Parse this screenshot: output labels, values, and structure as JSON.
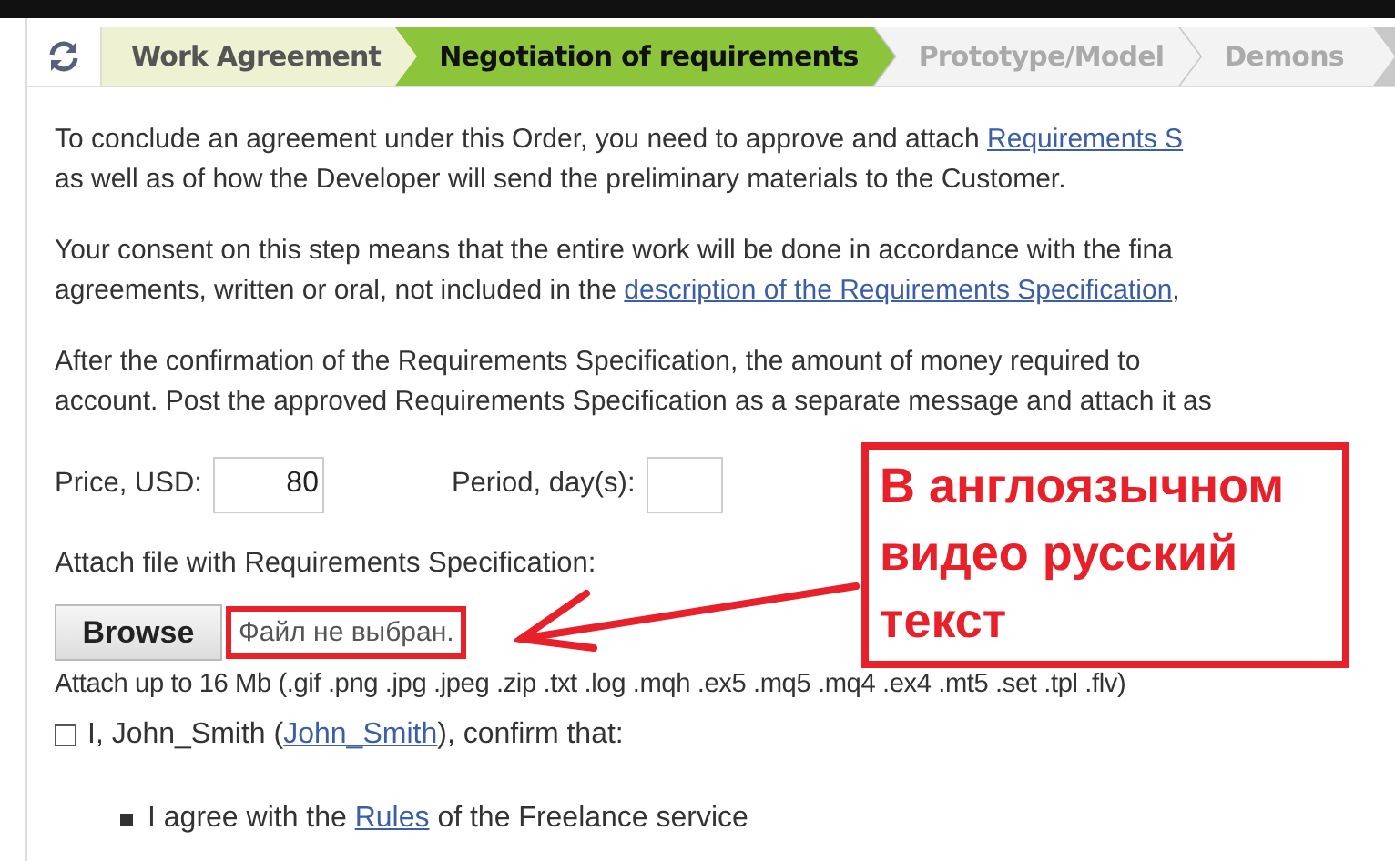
{
  "steps": [
    {
      "label": "Work Agreement",
      "done": true,
      "selected": false
    },
    {
      "label": "Negotiation of requirements",
      "done": false,
      "selected": true
    },
    {
      "label": "Prototype/Model",
      "done": false,
      "selected": false
    },
    {
      "label": "Demons",
      "done": false,
      "selected": false
    }
  ],
  "paragraphs": [
    [
      [
        {
          "text": "To conclude an agreement under this Order, you need to approve and attach "
        },
        {
          "text": "Requirements S",
          "link": true
        }
      ],
      [
        {
          "text": "as well as of how the Developer will send the preliminary materials to the Customer."
        }
      ]
    ],
    [
      [
        {
          "text": "Your consent on this step means that the entire work will be done in accordance with the fina"
        }
      ],
      [
        {
          "text": "agreements, written or oral, not included in the "
        },
        {
          "text": "description of the Requirements Specification",
          "link": true
        },
        {
          "text": ","
        }
      ]
    ],
    [
      [
        {
          "text": "After the confirmation of the Requirements Specification, the amount of money required to"
        }
      ],
      [
        {
          "text": "account. Post the approved Requirements Specification as a separate message and attach it as"
        }
      ]
    ]
  ],
  "price": {
    "label": "Price, USD:",
    "value": "80"
  },
  "period": {
    "label": "Period, day(s):"
  },
  "attach_label": "Attach file with Requirements Specification:",
  "browse_button": "Browse",
  "file_status": "Файл не выбран.",
  "attach_hint": "Attach up to 16 Mb (.gif .png .jpg .jpeg .zip .txt .log .mqh .ex5 .mq5 .mq4 .ex4 .mt5 .set .tpl .flv)",
  "confirm": {
    "checked": false,
    "segments": [
      {
        "text": "I, John_Smith ("
      },
      {
        "text": "John_Smith",
        "link": true
      },
      {
        "text": "), confirm that:"
      }
    ]
  },
  "bullets": [
    [
      {
        "text": "I agree with the "
      },
      {
        "text": "Rules",
        "link": true
      },
      {
        "text": " of the Freelance service"
      }
    ]
  ],
  "annotation": "В англоязычном видео русский текст"
}
